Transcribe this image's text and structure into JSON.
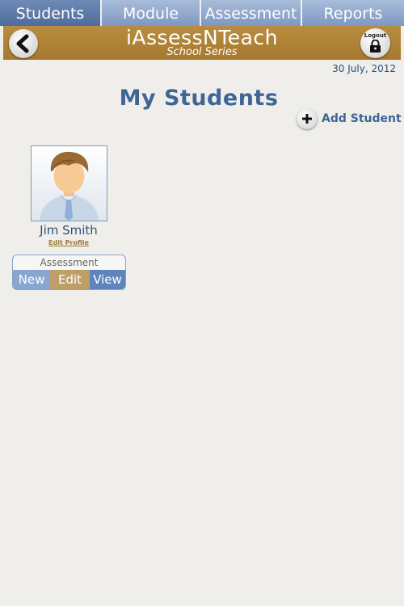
{
  "tabs": [
    {
      "label": "Students",
      "active": true
    },
    {
      "label": "Module",
      "active": false
    },
    {
      "label": "Assessment",
      "active": false
    },
    {
      "label": "Reports",
      "active": false
    }
  ],
  "header": {
    "title": "iAssessNTeach",
    "subtitle": "School Series",
    "back_icon": "back-arrow-icon",
    "logout_label": "Logout",
    "logout_icon": "lock-icon"
  },
  "date": "30 July, 2012",
  "page": {
    "title": "My Students",
    "add_student_label": "Add Student",
    "add_icon": "plus-icon"
  },
  "students": [
    {
      "name": "Jim Smith",
      "edit_profile_label": "Edit Profile",
      "assessment_label": "Assessment",
      "buttons": {
        "new": "New",
        "edit": "Edit",
        "view": "View"
      }
    }
  ],
  "colors": {
    "background": "#efeeea",
    "header_brown": "#b0843a",
    "tab_blue": "#8fa4c6",
    "tab_active": "#5a78a8",
    "title_blue": "#3f6597",
    "new_btn": "#88a6d0",
    "edit_btn": "#bd9d68",
    "view_btn": "#5e84bd"
  }
}
